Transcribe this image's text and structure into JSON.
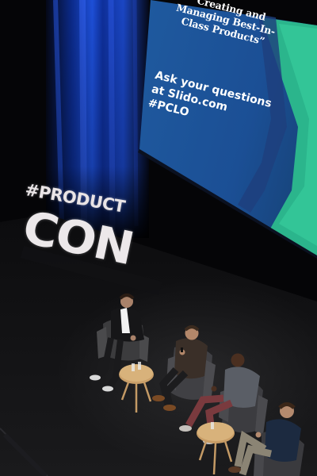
{
  "screen": {
    "title": "“Creating and Managing Best-In-Class Products”",
    "lines": [
      "Ask your questions",
      "at Slido.com",
      "#PCLO"
    ]
  },
  "stage_sign": {
    "top": "#PRODUCT",
    "bottom": "CON"
  },
  "colors": {
    "backdrop": "#050507",
    "curtain_blue": "#1d4fd8",
    "screen_blue": "#1b4f95",
    "screen_green": "#24b88a",
    "stage_floor": "#141416"
  }
}
